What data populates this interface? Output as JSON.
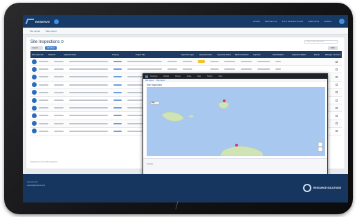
{
  "app": {
    "brand": "RESERVE",
    "nav": [
      "HOME",
      "PROJECTS",
      "SITE INSPECTIONS",
      "REPORTS",
      "ADMIN"
    ]
  },
  "subnav": [
    "Site Layout",
    "Map Layout"
  ],
  "page": {
    "title": "Site Inspections",
    "buttons": [
      "Export",
      "Add New"
    ],
    "search_placeholder": "Search Site Inspections",
    "filter_label": "Filter",
    "columns": [
      "Site Inspection",
      "Batch ID",
      "Applicant Name",
      "Property",
      "Project Title",
      "Inspection Type",
      "Inspection Date",
      "Inspection Status",
      "Batch Interaction",
      "Inspector",
      "Work Related",
      "Inspection Status",
      "Events",
      "Manager Comment"
    ],
    "row_count": 10,
    "footer_note": "Showing 1 to 10 of 64 inspections"
  },
  "modal": {
    "tabs": [
      "Overview",
      "Details",
      "Photos",
      "Notes",
      "Map",
      "History",
      "Files"
    ],
    "subnav": [
      "Site Layout",
      "Map Layout"
    ],
    "title": "Site Inspection",
    "map_type": "Map",
    "foot_label": "Location",
    "logo": "RESOURCE"
  },
  "footer": {
    "phone": "(xxx) xxx-xxxx",
    "email": "support@resource.com",
    "brand": "RESOURCE SOLUTIONS"
  },
  "colors": {
    "header": "#183a67",
    "accent": "#2b6cb8",
    "status_pill": "#f2c230",
    "map_water": "#a9c8ef",
    "map_land": "#cfe3b5"
  }
}
